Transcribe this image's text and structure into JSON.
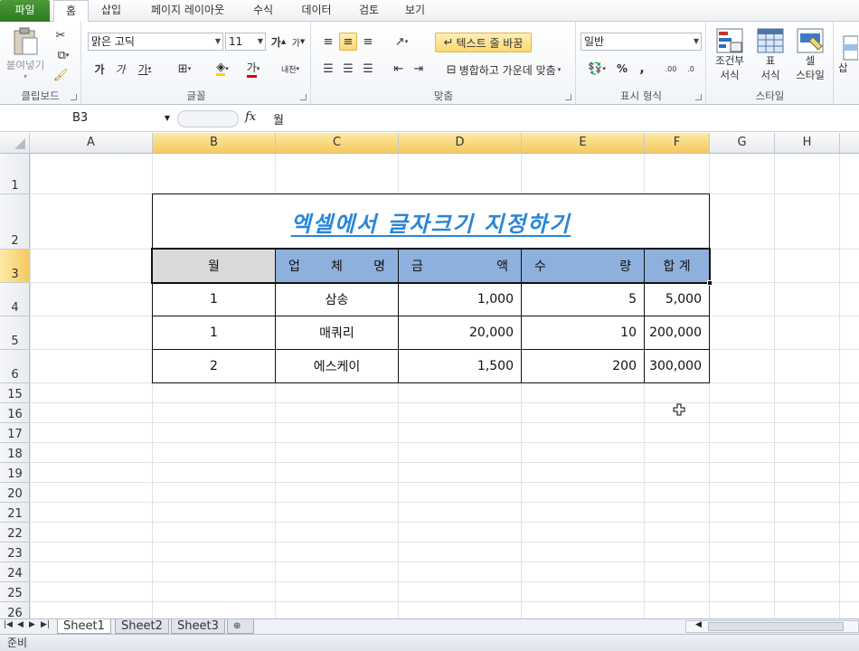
{
  "tabs": [
    "파일",
    "홈",
    "삽입",
    "페이지 레이아웃",
    "수식",
    "데이터",
    "검토",
    "보기"
  ],
  "active_tab": "홈",
  "ribbon": {
    "clipboard": {
      "label": "클립보드",
      "paste": "붙여넣기"
    },
    "font": {
      "label": "글꼴",
      "name": "맑은 고딕",
      "size": "11",
      "bold": "가",
      "italic": "가",
      "underline": "가",
      "grow": "가",
      "shrink": "가",
      "font_color_char": "가",
      "phonetic": "내천"
    },
    "alignment": {
      "label": "맞춤",
      "wrap": "텍스트 줄 바꿈",
      "merge": "병합하고 가운데 맞춤"
    },
    "number": {
      "label": "표시 형식",
      "format": "일반",
      "percent": "%",
      "comma": ",",
      "inc": ".00",
      "dec": ".0"
    },
    "styles": {
      "label": "스타일",
      "conditional": [
        "조건부",
        "서식"
      ],
      "table": [
        "표",
        "서식"
      ],
      "cell": [
        "셀",
        "스타일"
      ]
    },
    "insert_partial": "삽"
  },
  "formula_bar": {
    "name_box": "B3",
    "fx": "fx",
    "content": "월"
  },
  "columns": [
    "A",
    "B",
    "C",
    "D",
    "E",
    "F",
    "G",
    "H"
  ],
  "selected_columns": [
    "B",
    "C",
    "D",
    "E",
    "F"
  ],
  "rows": [
    "1",
    "2",
    "3",
    "4",
    "5",
    "6",
    "15",
    "16",
    "17",
    "18",
    "19",
    "20",
    "21",
    "22",
    "23",
    "24",
    "25",
    "26"
  ],
  "selected_row": "3",
  "sheet": {
    "title": "엑셀에서 글자크기 지정하기",
    "headers": [
      {
        "chars": [
          "월"
        ]
      },
      {
        "chars": [
          "업",
          "체",
          "명"
        ]
      },
      {
        "chars": [
          "금",
          "액"
        ]
      },
      {
        "chars": [
          "수",
          "량"
        ]
      },
      {
        "chars": [
          "합",
          "계"
        ]
      }
    ],
    "data": [
      [
        "1",
        "삼송",
        "1,000",
        "5",
        "5,000"
      ],
      [
        "1",
        "매쿼리",
        "20,000",
        "10",
        "200,000"
      ],
      [
        "2",
        "에스케이",
        "1,500",
        "200",
        "300,000"
      ]
    ]
  },
  "sheet_tabs": [
    "Sheet1",
    "Sheet2",
    "Sheet3"
  ],
  "active_sheet": "Sheet1",
  "status": "준비",
  "colors": {
    "header_fill": "#8eb0dc",
    "first_header_fill": "#d9d9d9",
    "title_color": "#2a86d8",
    "file_tab": "#2e7a20"
  }
}
